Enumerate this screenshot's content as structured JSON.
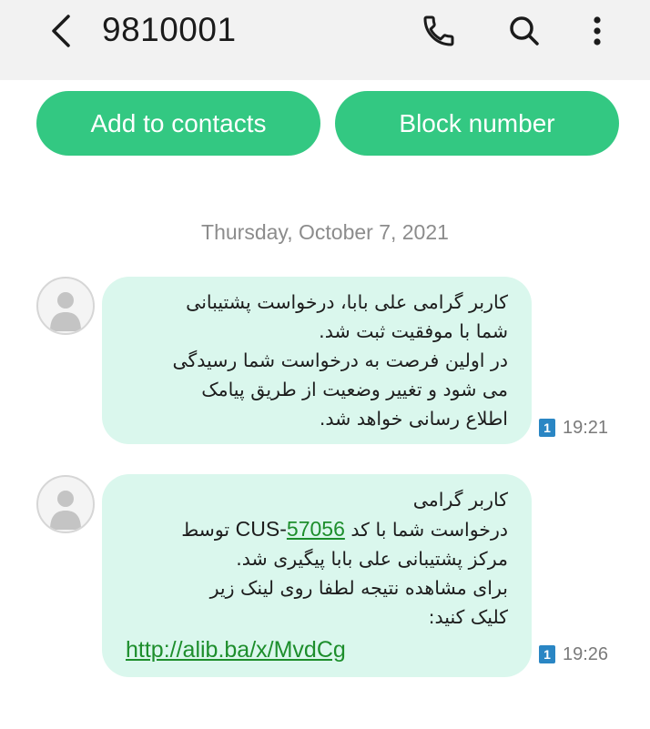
{
  "header": {
    "contact": "9810001",
    "back_icon": "back-arrow-icon",
    "call_icon": "phone-icon",
    "search_icon": "search-icon",
    "more_icon": "more-vertical-icon"
  },
  "actions": {
    "add_to_contacts": "Add to contacts",
    "block_number": "Block number"
  },
  "date_separator": "Thursday, October 7, 2021",
  "messages": [
    {
      "lines": [
        "کاربر گرامی علی بابا، درخواست پشتیبانی",
        "شما با موفقیت ثبت شد.",
        "در اولین فرصت به درخواست شما رسیدگی",
        "می شود و تغییر وضعیت از طریق پیامک",
        "اطلاع رسانی خواهد شد."
      ],
      "sim": "1",
      "time": "19:21"
    },
    {
      "lines": [
        "کاربر گرامی",
        "درخواست شما با کد",
        "CUS-",
        "57056",
        "توسط",
        "مرکز پشتیبانی علی بابا پیگیری شد.",
        "برای مشاهده نتیجه لطفا روی لینک زیر",
        "کلیک کنید:"
      ],
      "url": "http://alib.ba/x/MvdCg",
      "sim": "1",
      "time": "19:26"
    }
  ],
  "colors": {
    "accent_green": "#33c882",
    "bubble": "#daf7ed",
    "link": "#1d8e2c",
    "sim_badge": "#2a86c4"
  }
}
